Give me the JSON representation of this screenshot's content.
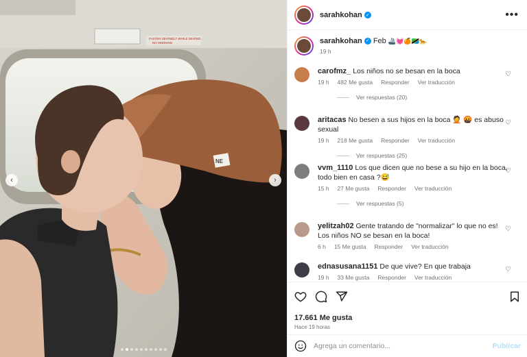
{
  "header": {
    "username": "sarahkohan",
    "more_icon": "more-horizontal-icon"
  },
  "caption": {
    "username": "sarahkohan",
    "text": "Feb",
    "emojis": "🚢💓🍊🇹🇿🐆",
    "time": "19 h"
  },
  "comments": [
    {
      "username": "carofmz_",
      "text": "Los niños no se besan en la boca",
      "time": "19 h",
      "likes": "482 Me gusta",
      "reply": "Responder",
      "translate": "Ver traducción",
      "replies": "Ver respuestas (20)",
      "avatar_color": "#c77d4a"
    },
    {
      "username": "aritacas",
      "text": "No besen a sus hijos en la boca 🤦 🤬 es abuso sexual",
      "time": "19 h",
      "likes": "218 Me gusta",
      "reply": "Responder",
      "translate": "Ver traducción",
      "replies": "Ver respuestas (25)",
      "avatar_color": "#5a3a3f"
    },
    {
      "username": "vvm_1110",
      "text": "Los que dicen que no bese a su hijo en la boca, todo bien en casa ?😅",
      "time": "15 h",
      "likes": "27 Me gusta",
      "reply": "Responder",
      "translate": "Ver traducción",
      "replies": "Ver respuestas (5)",
      "avatar_color": "#7d7d7d"
    },
    {
      "username": "yelitzah02",
      "text": "Gente tratando de \"normalizar\" lo que no es! Los niños NO se besan en la boca!",
      "time": "6 h",
      "likes": "15 Me gusta",
      "reply": "Responder",
      "translate": "Ver traducción",
      "replies": "",
      "avatar_color": "#b89a8a"
    },
    {
      "username": "ednasusana1151",
      "text": "De que vive? En que trabaja",
      "time": "19 h",
      "likes": "33 Me gusta",
      "reply": "Responder",
      "translate": "Ver traducción",
      "replies": "",
      "avatar_color": "#3d3d45"
    }
  ],
  "actions": {
    "like_icon": "heart-icon",
    "comment_icon": "comment-icon",
    "share_icon": "share-icon",
    "save_icon": "bookmark-icon",
    "likes": "17.661 Me gusta",
    "time_ago": "Hace 19 horas"
  },
  "composer": {
    "placeholder": "Agrega un comentario...",
    "publish": "Publicar",
    "emoji_icon": "emoji-icon"
  },
  "carousel": {
    "total": 10,
    "active": 2
  },
  "photo_labels": {
    "sign1": "FASTEN SEATBELT WHILE SEATED",
    "sign2": "NO SMOKING",
    "cap_logo": "NE"
  },
  "colors": {
    "accent": "#0095f6",
    "muted": "#737373",
    "publish_disabled": "#b2dffc"
  }
}
